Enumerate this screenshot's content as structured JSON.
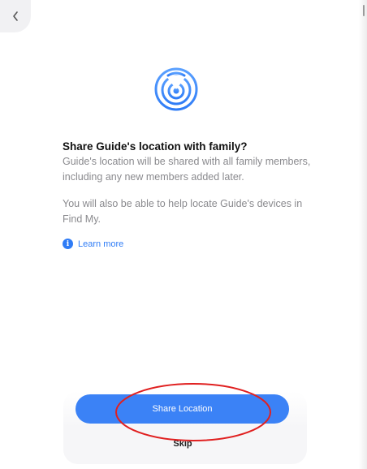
{
  "header": {
    "back_icon": "chevron-left-icon"
  },
  "hero": {
    "icon": "location-signal-icon",
    "accent_color": "#2f7cf6"
  },
  "main": {
    "title": "Share Guide's location with family?",
    "paragraph_1": "Guide's location will be shared with all family members, including any new members added later.",
    "paragraph_2": "You will also be able to help locate Guide's devices in Find My.",
    "learn_more_label": "Learn more",
    "learn_more_icon": "info-icon"
  },
  "actions": {
    "primary_label": "Share Location",
    "primary_color": "#3b82f6",
    "secondary_label": "Skip"
  },
  "annotation": {
    "ellipse_color": "#e02020"
  }
}
